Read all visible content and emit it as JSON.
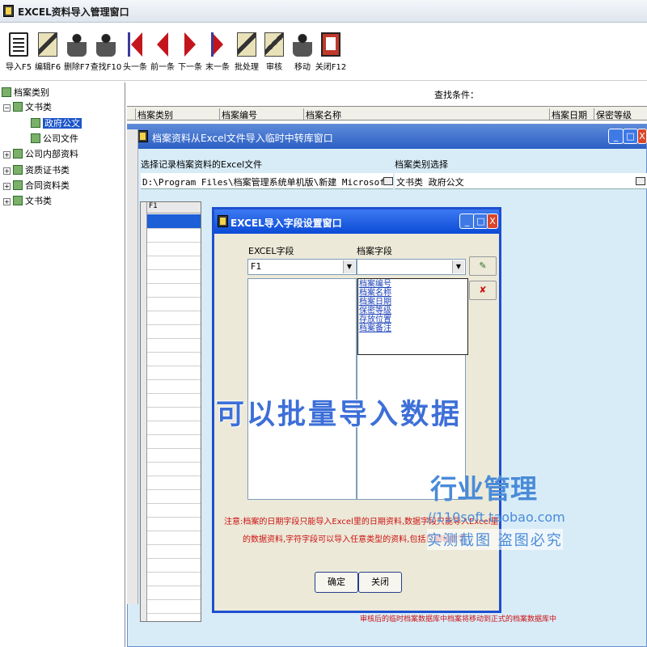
{
  "window": {
    "title": "EXCEL资料导入管理窗口"
  },
  "toolbar": {
    "buttons": [
      {
        "label": "导入F5",
        "icon": "import-icon"
      },
      {
        "label": "编辑F6",
        "icon": "edit-icon"
      },
      {
        "label": "删除F7",
        "icon": "delete-icon"
      },
      {
        "label": "查找F10",
        "icon": "find-icon"
      },
      {
        "label": "头一条",
        "icon": "first-record-icon"
      },
      {
        "label": "前一条",
        "icon": "prev-record-icon"
      },
      {
        "label": "下一条",
        "icon": "next-record-icon"
      },
      {
        "label": "末一条",
        "icon": "last-record-icon"
      },
      {
        "label": "批处理",
        "icon": "batch-icon"
      },
      {
        "label": "审核",
        "icon": "audit-icon"
      },
      {
        "label": "移动",
        "icon": "move-icon"
      },
      {
        "label": "关闭F12",
        "icon": "close-door-icon"
      }
    ]
  },
  "search": {
    "label": "查找条件："
  },
  "tree": {
    "root": "档案类别",
    "nodes": [
      {
        "label": "文书类",
        "level": 1,
        "expanded": true
      },
      {
        "label": "政府公文",
        "level": 2,
        "selected": true
      },
      {
        "label": "公司文件",
        "level": 2
      },
      {
        "label": "公司内部资料",
        "level": 1
      },
      {
        "label": "资质证书类",
        "level": 1
      },
      {
        "label": "合同资料类",
        "level": 1
      },
      {
        "label": "文书类",
        "level": 1
      }
    ]
  },
  "grid": {
    "columns": [
      "档案类别",
      "档案编号",
      "档案名称",
      "档案日期",
      "保密等级"
    ]
  },
  "import_window": {
    "title": "档案资料从Excel文件导入临时中转库窗口",
    "file_label": "选择记录档案资料的Excel文件",
    "file_value": "D:\\Program Files\\档案管理系统单机版\\新建 Microsoft Excel 工作表.xls",
    "category_label": "档案类别选择",
    "category_value": "文书类 政府公文",
    "grid_header": "F1"
  },
  "field_dialog": {
    "title": "EXCEL导入字段设置窗口",
    "excel_field_label": "EXCEL字段",
    "excel_field_value": "F1",
    "archive_field_label": "档案字段",
    "archive_field_value": "",
    "dropdown_options": [
      "档案编号",
      "档案名称",
      "档案日期",
      "保密等级",
      "存放位置",
      "档案备注"
    ],
    "notice_line1": "注意:档案的日期字段只能导入Excel里的日期资料,数据字段只能导入Excel里",
    "notice_line2": "的数据资料,字符字段可以导入任意类型的资料,包括日期和数字",
    "ok_label": "确定",
    "close_label": "关闭"
  },
  "overlays": {
    "caption": "可以批量导入数据",
    "watermark_title": "行业管理",
    "watermark_url": "//110soft.taobao.com",
    "watermark_warning": "实测截图 盗图必究",
    "bottom_note": "审核后的临时档案数据库中档案将移动到正式的档案数据库中"
  },
  "colors": {
    "title_blue": "#2c5fc5",
    "dialog_blue": "#1d4fcf",
    "selection_blue": "#1b55c9",
    "notice_red": "#cc1111",
    "panel_bg": "#d8ecf8"
  }
}
